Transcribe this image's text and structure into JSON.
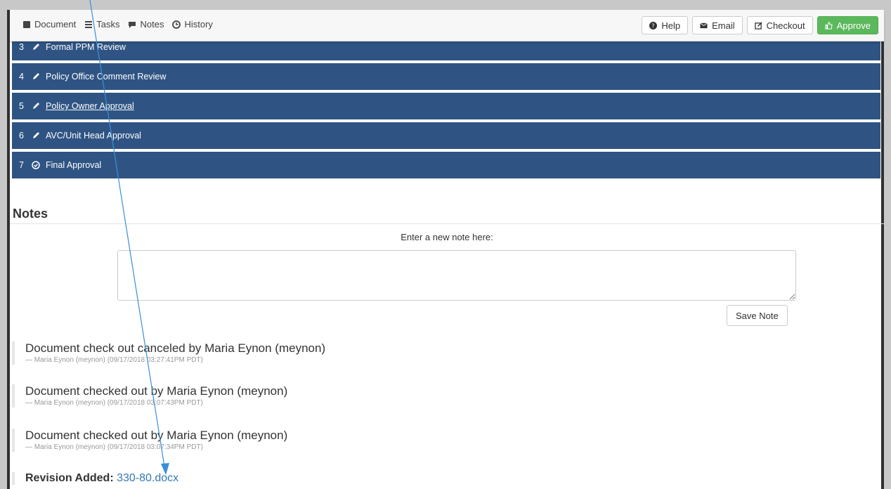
{
  "toolbar": {
    "nav": [
      {
        "label": "Document",
        "icon": "book-icon"
      },
      {
        "label": "Tasks",
        "icon": "tasks-icon"
      },
      {
        "label": "Notes",
        "icon": "comment-icon"
      },
      {
        "label": "History",
        "icon": "clock-icon"
      }
    ],
    "actions": {
      "help": "Help",
      "email": "Email",
      "checkout": "Checkout",
      "approve": "Approve"
    }
  },
  "steps": [
    {
      "num": "3",
      "label": "Formal PPM Review",
      "icon": "pencil-icon"
    },
    {
      "num": "4",
      "label": "Policy Office Comment Review",
      "icon": "pencil-icon"
    },
    {
      "num": "5",
      "label": "Policy Owner Approval",
      "icon": "pencil-icon"
    },
    {
      "num": "6",
      "label": "AVC/Unit Head Approval",
      "icon": "pencil-icon"
    },
    {
      "num": "7",
      "label": "Final Approval",
      "icon": "check-circle-icon"
    }
  ],
  "notes": {
    "title": "Notes",
    "prompt": "Enter a new note here:",
    "save_label": "Save Note",
    "entries": [
      {
        "text": "Document check out canceled by Maria Eynon (meynon)",
        "meta": "— Maria Eynon (meynon) (09/17/2018 03:27:41PM PDT)"
      },
      {
        "text": "Document checked out by Maria Eynon (meynon)",
        "meta": "— Maria Eynon (meynon) (09/17/2018 03:07:43PM PDT)"
      },
      {
        "text": "Document checked out by Maria Eynon (meynon)",
        "meta": "— Maria Eynon (meynon) (09/17/2018 03:07:34PM PDT)"
      }
    ],
    "revision": {
      "label": "Revision Added:",
      "file": "330-80.docx"
    }
  },
  "colors": {
    "step_bar": "#2f5483",
    "approve": "#5cb85c",
    "link": "#337ab7",
    "annotation_arrow": "#3a8fd6"
  }
}
